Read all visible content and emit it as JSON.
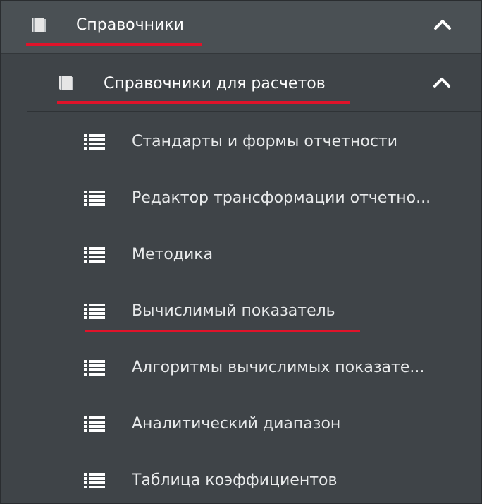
{
  "menu": {
    "root": {
      "label": "Справочники",
      "icon": "book-icon",
      "expanded": true
    },
    "group": {
      "label": "Справочники для расчетов",
      "icon": "book-icon",
      "expanded": true
    },
    "items": [
      {
        "label": "Стандарты и формы отчетности",
        "icon": "list-icon"
      },
      {
        "label": "Редактор трансформации отчетно...",
        "icon": "list-icon"
      },
      {
        "label": "Методика",
        "icon": "list-icon"
      },
      {
        "label": "Вычислимый показатель",
        "icon": "list-icon"
      },
      {
        "label": "Алгоритмы вычислимых показате...",
        "icon": "list-icon"
      },
      {
        "label": "Аналитический диапазон",
        "icon": "list-icon"
      },
      {
        "label": "Таблица коэффициентов",
        "icon": "list-icon"
      }
    ]
  },
  "colors": {
    "background": "#3f4448",
    "root_header": "#4a5054",
    "text": "#ffffff",
    "highlight_underline": "#e0132a"
  }
}
